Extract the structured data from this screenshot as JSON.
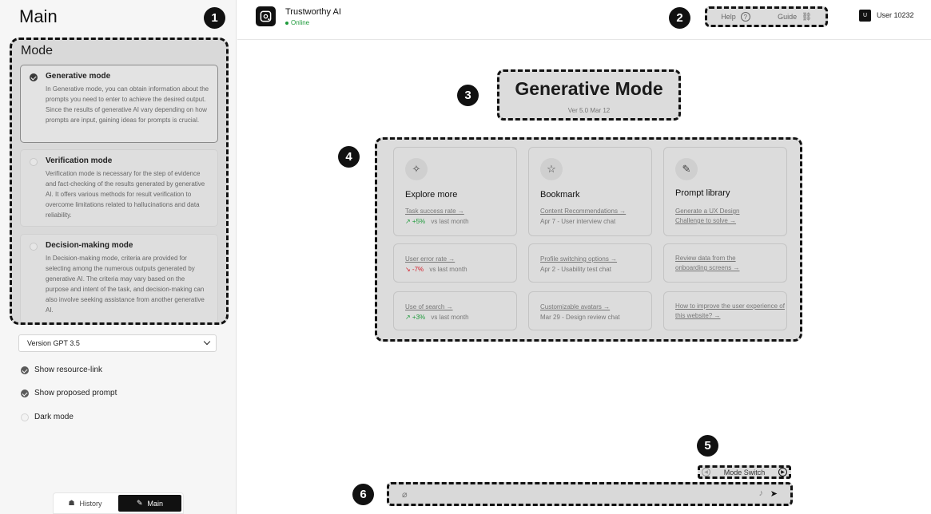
{
  "sidebar": {
    "title": "Main",
    "mode_heading": "Mode",
    "modes": [
      {
        "title": "Generative mode",
        "description": "In Generative mode, you can obtain information about the prompts you need to enter to achieve the desired output. Since the results of generative AI vary depending on how prompts are input, gaining ideas for prompts is crucial.",
        "selected": true
      },
      {
        "title": "Verification mode",
        "description": "Verification mode is necessary for the step of evidence and fact-checking of the results generated by generative AI. It offers various methods for result verification to overcome limitations related to hallucinations and data reliability.",
        "selected": false
      },
      {
        "title": "Decision-making mode",
        "description": "In Decision-making mode, criteria are provided for selecting among the numerous outputs generated by generative AI. The criteria may vary based on the purpose and intent of the task, and decision-making can also involve seeking assistance from another generative AI.",
        "selected": false
      }
    ],
    "version_select": "Version GPT 3.5",
    "options": [
      {
        "label": "Show resource-link",
        "checked": true
      },
      {
        "label": "Show proposed prompt",
        "checked": true
      },
      {
        "label": "Dark mode",
        "checked": false
      }
    ],
    "tabs": [
      {
        "label": "History",
        "active": false
      },
      {
        "label": "Main",
        "active": true
      }
    ]
  },
  "header": {
    "app_name": "Trustworthy AI",
    "status": "Online",
    "help_label": "Help",
    "guide_label": "Guide",
    "user_initial": "U",
    "user_name": "User 10232"
  },
  "main": {
    "mode_title": "Generative Mode",
    "version_text": "Ver 5.0 Mar 12",
    "columns": [
      {
        "title": "Explore more",
        "icon": "sparkle-icon",
        "top_link": "Task success rate →",
        "top_meta_value": "↗ +5%",
        "top_meta_trend": "up",
        "top_meta_text": "vs last month",
        "cards": [
          {
            "link": "User error rate →",
            "meta_value": "↘ -7%",
            "meta_trend": "down",
            "meta_text": "vs last month"
          },
          {
            "link": "Use of search →",
            "meta_value": "↗ +3%",
            "meta_trend": "up",
            "meta_text": "vs last month"
          }
        ]
      },
      {
        "title": "Bookmark",
        "icon": "star-icon",
        "top_link": "Content Recommendations →",
        "top_meta_text": "Apr 7 - User interview chat",
        "cards": [
          {
            "link": "Profile switching options →",
            "meta_text": "Apr 2 - Usability test chat"
          },
          {
            "link": "Customizable avatars →",
            "meta_text": "Mar 29 - Design review chat"
          }
        ]
      },
      {
        "title": "Prompt library",
        "icon": "pencil-icon",
        "top_link": "Generate a UX Design Challenge to solve →",
        "cards": [
          {
            "link": "Review data from the onboarding screens →"
          },
          {
            "link": "How to improve the user experience of this website? →"
          }
        ]
      }
    ],
    "mode_switch_label": "Mode Switch"
  },
  "badges": [
    "1",
    "2",
    "3",
    "4",
    "5",
    "6"
  ]
}
